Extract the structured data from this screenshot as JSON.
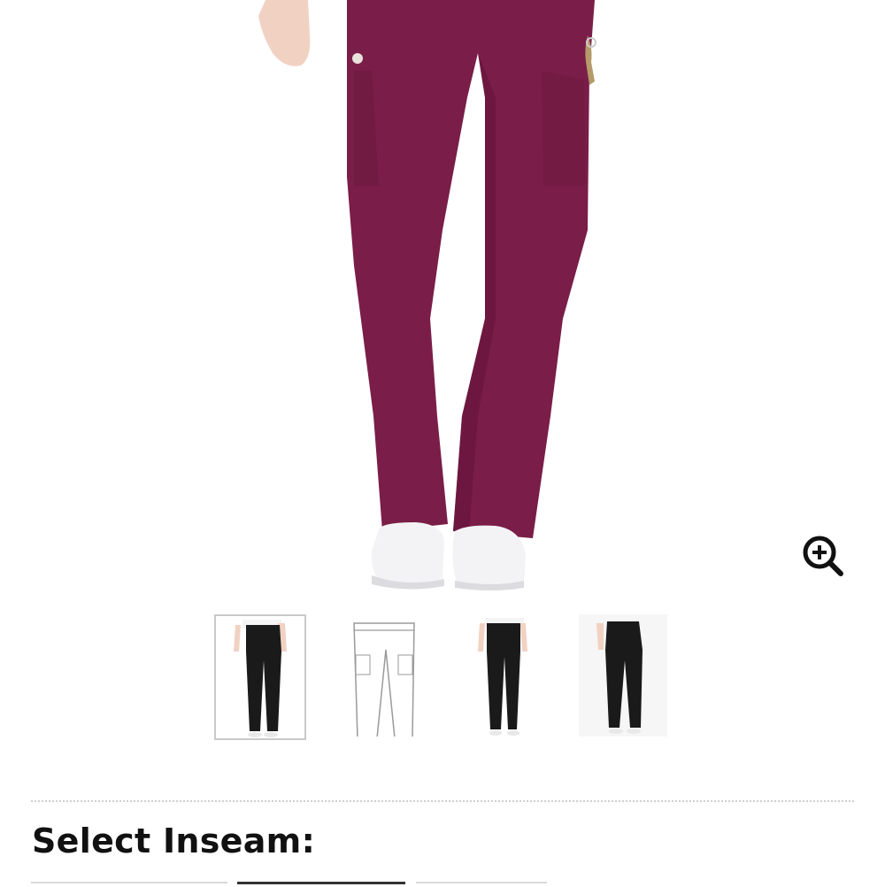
{
  "product": {
    "main_image": {
      "alt": "",
      "pant_color": "#7a1d48"
    },
    "zoom": {
      "icon": "zoom-in-icon"
    },
    "thumbnails": [
      {
        "view": "front-model",
        "selected": true
      },
      {
        "view": "flat-sketch",
        "selected": false
      },
      {
        "view": "front-model-2",
        "selected": false
      },
      {
        "view": "back-model",
        "selected": false
      }
    ]
  },
  "inseam": {
    "title": "Select Inseam:",
    "options": [
      {
        "label": "",
        "selected": false
      },
      {
        "label": "",
        "selected": true
      },
      {
        "label": "",
        "selected": false
      }
    ]
  },
  "colors": {
    "thumb_pant": "#1a1a1a",
    "divider": "#cfcfcf",
    "text": "#111111"
  }
}
